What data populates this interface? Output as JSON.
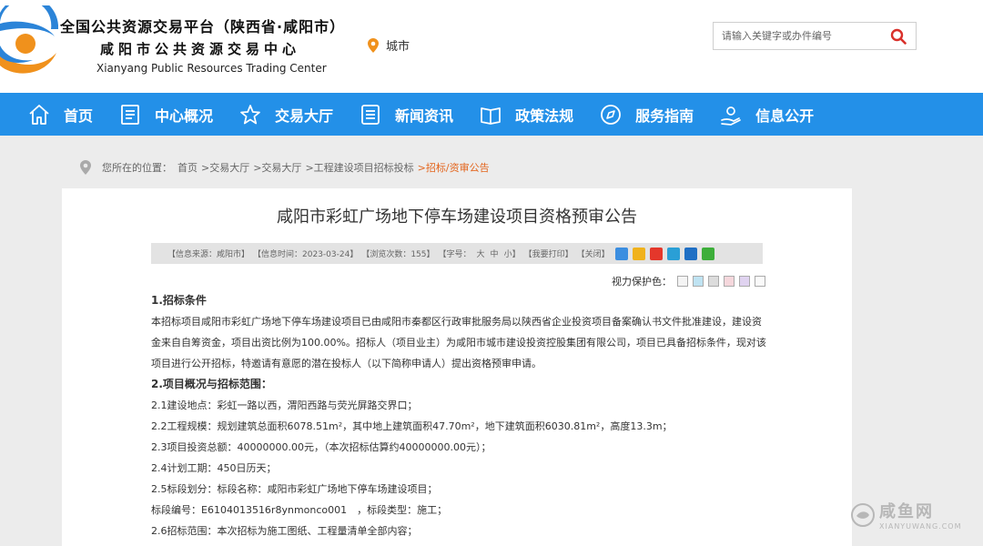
{
  "header": {
    "title_cn": "全国公共资源交易平台（陕西省·咸阳市）",
    "subtitle_cn": "咸阳市公共资源交易中心",
    "title_en": "Xianyang Public Resources Trading Center",
    "city_label": "城市",
    "search_placeholder": "请输入关键字或办件编号"
  },
  "nav": {
    "items": [
      {
        "label": "首页",
        "icon": "home-icon"
      },
      {
        "label": "中心概况",
        "icon": "document-icon"
      },
      {
        "label": "交易大厅",
        "icon": "star-icon"
      },
      {
        "label": "新闻资讯",
        "icon": "list-icon"
      },
      {
        "label": "政策法规",
        "icon": "book-icon"
      },
      {
        "label": "服务指南",
        "icon": "compass-icon"
      },
      {
        "label": "信息公开",
        "icon": "hand-icon"
      }
    ]
  },
  "breadcrumb": {
    "prefix": "您所在的位置：",
    "items": [
      "首页",
      ">交易大厅",
      ">交易大厅",
      ">工程建设项目招标投标",
      ">招标/资审公告"
    ]
  },
  "article": {
    "title": "咸阳市彩虹广场地下停车场建设项目资格预审公告",
    "meta": {
      "source": "【信息来源：咸阳市】",
      "time": "【信息时间：2023-03-24】",
      "views": "【浏览次数：155】",
      "font": "【字号：",
      "font_l": "大",
      "font_m": "中",
      "font_s": "小】",
      "print": "【我要打印】",
      "close": "【关闭】"
    },
    "protect_label": "视力保护色：",
    "sections": {
      "s1_heading": "1.招标条件",
      "s1_text": "本招标项目咸阳市彩虹广场地下停车场建设项目已由咸阳市秦都区行政审批服务局以陕西省企业投资项目备案确认书文件批准建设，建设资金来自自筹资金，项目出资比例为100.00%。招标人（项目业主）为咸阳市城市建设投资控股集团有限公司，项目已具备招标条件，现对该项目进行公开招标，特邀请有意愿的潜在投标人（以下简称申请人）提出资格预审申请。",
      "s2_heading": "2.项目概况与招标范围：",
      "l21": "2.1建设地点：彩虹一路以西，渭阳西路与荧光屏路交界口；",
      "l22": "2.2工程规模：规划建筑总面积6078.51m²，其中地上建筑面积47.70m²，地下建筑面积6030.81m²，高度13.3m；",
      "l23": "2.3项目投资总额：40000000.00元，（本次招标估算约40000000.00元）；",
      "l24": "2.4计划工期：450日历天；",
      "l25": "2.5标段划分：标段名称：咸阳市彩虹广场地下停车场建设项目；",
      "l25b": "标段编号：E6104013516r8ynmonco001　，标段类型：施工；",
      "l26": "2.6招标范围：本次招标为施工图纸、工程量清单全部内容；"
    }
  },
  "watermark": {
    "cn": "咸鱼网",
    "en": "XIANYUWANG.COM"
  },
  "colors": {
    "nav": "#2390e8",
    "accent": "#e3651d",
    "logo_blue": "#2b84d8",
    "logo_orange": "#f0911c"
  }
}
